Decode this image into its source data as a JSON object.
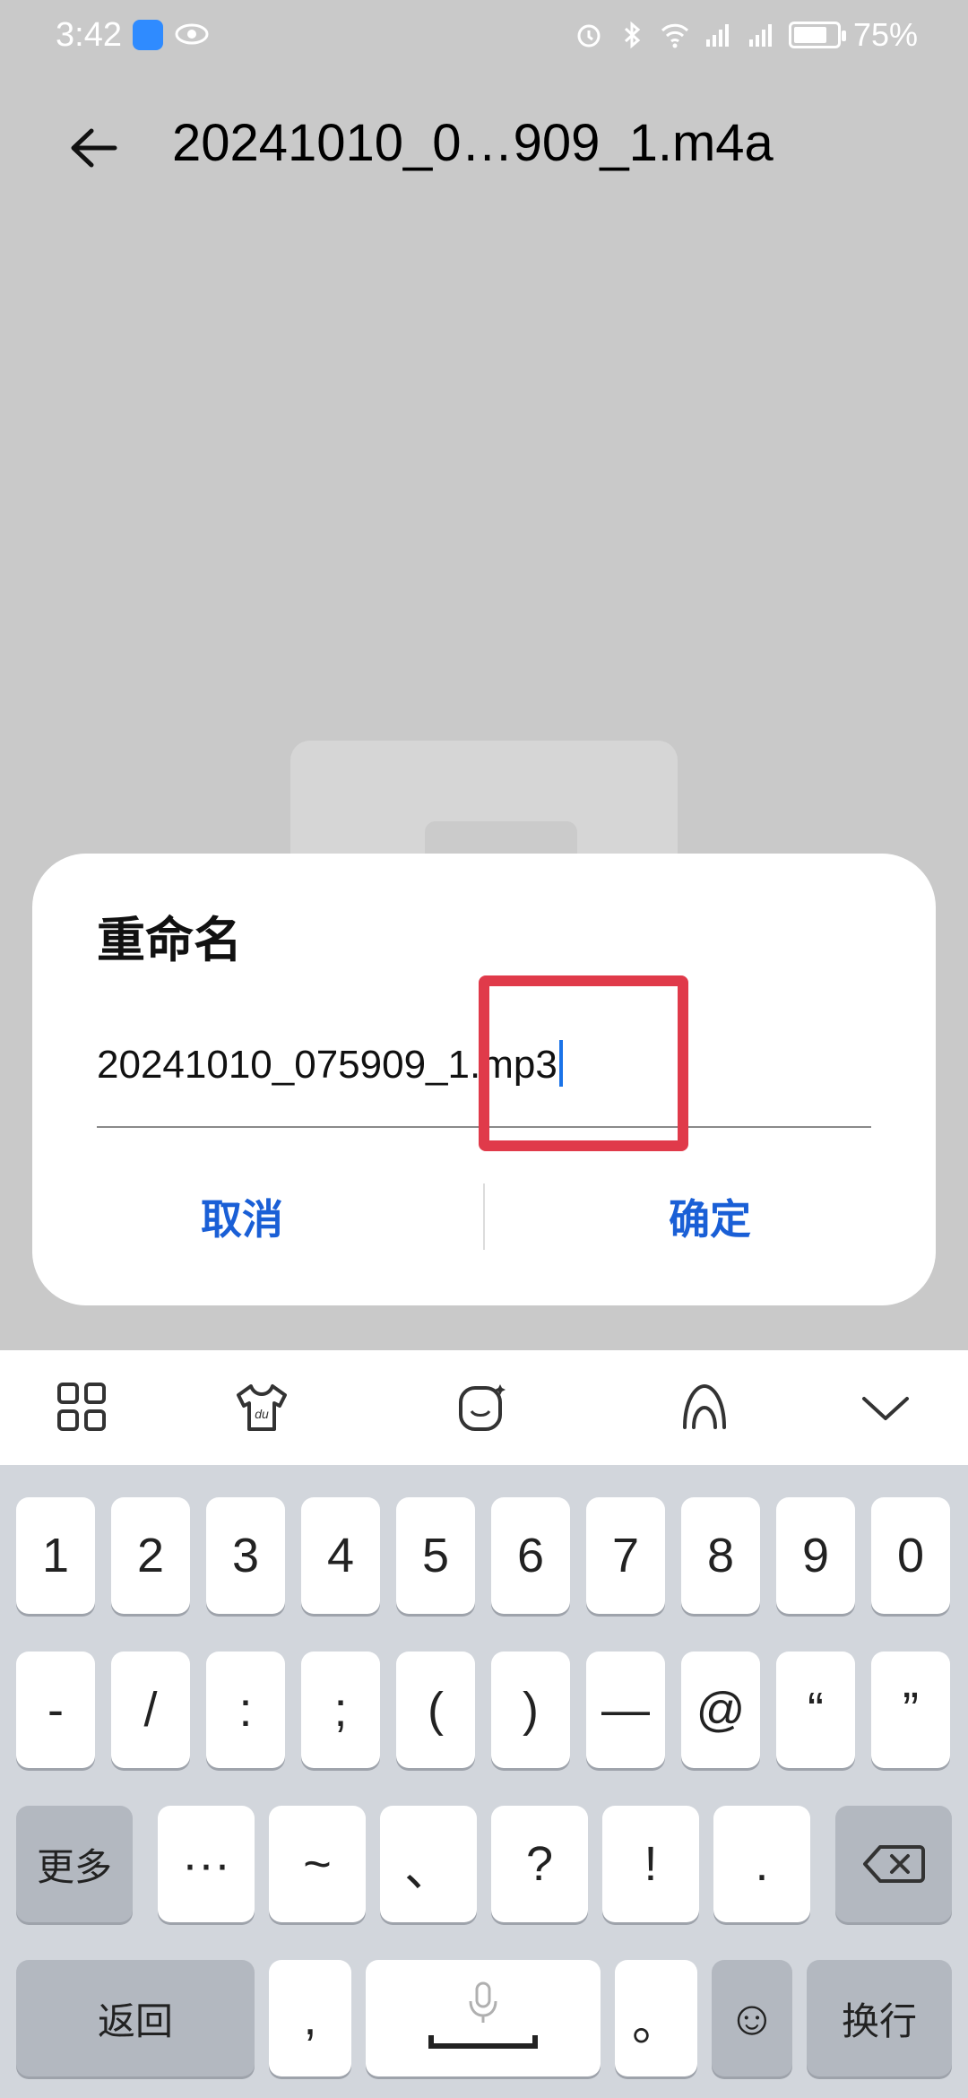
{
  "status": {
    "time": "3:42",
    "battery_text": "75%",
    "icons": [
      "app-notification-icon",
      "eye-icon",
      "alarm-icon",
      "bluetooth-icon",
      "wifi-icon",
      "signal-4g-icon",
      "signal-4g-icon-2",
      "battery-icon"
    ]
  },
  "header": {
    "back_icon": "arrow-left-icon",
    "file_title": "20241010_0…909_1.m4a"
  },
  "dialog": {
    "title": "重命名",
    "input_value": "20241010_075909_1.mp3",
    "cancel_label": "取消",
    "confirm_label": "确定",
    "highlight_color": "#e03a4a"
  },
  "keyboard_toolbar": {
    "icons": [
      "grid-menu-icon",
      "skin-shirt-icon",
      "emoji-face-icon",
      "handwriting-a-icon",
      "collapse-chevron-down-icon"
    ]
  },
  "keyboard": {
    "row1": [
      "1",
      "2",
      "3",
      "4",
      "5",
      "6",
      "7",
      "8",
      "9",
      "0"
    ],
    "row2": [
      "-",
      "/",
      ":",
      ";",
      "(",
      ")",
      "—",
      "@",
      "“",
      "”"
    ],
    "row3": [
      "更多",
      "···",
      "~",
      "、",
      "?",
      "!",
      ".",
      "⌫"
    ],
    "row4": [
      "返回",
      ",",
      "",
      "。",
      "☺",
      "换行"
    ],
    "space_icon": "microphone-icon"
  },
  "colors": {
    "accent_blue": "#1a5fd6",
    "keyboard_bg": "#d2d6dc",
    "overlay_bg": "#c9c9c9"
  }
}
